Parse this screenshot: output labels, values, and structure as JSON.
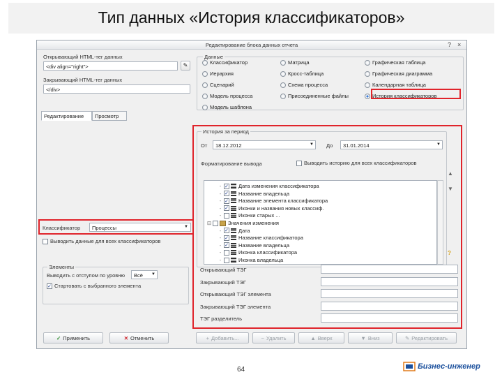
{
  "slide": {
    "title": "Тип данных «История классификаторов»",
    "page_number": "64",
    "brand": "Бизнес-инженер"
  },
  "window": {
    "title": "Редактирование блока данных отчета",
    "help_glyph": "?",
    "close_glyph": "×"
  },
  "left_panel": {
    "open_tag_label": "Открывающий HTML-тег данных",
    "open_tag_value": "<div align=\"right\">",
    "close_tag_label": "Закрывающий HTML-тег данных",
    "close_tag_value": "</div>",
    "picker_glyph": "✎",
    "tabs": [
      "Редактирование",
      "Просмотр"
    ],
    "classifier_label": "Классификатор",
    "classifier_value": "Процессы",
    "use_all_label": "Выводить данные для всех классификаторов",
    "elements_group": {
      "legend": "Элементы",
      "levels_label": "Выводить с отступом по уровню",
      "levels_value": "Всё",
      "start_selected_label": "Стартовать с выбранного элемента",
      "start_selected_checked": true
    }
  },
  "data_group": {
    "legend": "Данные",
    "options": [
      {
        "label": "Классификатор",
        "selected": false
      },
      {
        "label": "Матрица",
        "selected": false
      },
      {
        "label": "Графическая таблица",
        "selected": false
      },
      {
        "label": "Иерархия",
        "selected": false
      },
      {
        "label": "Кросс-таблица",
        "selected": false
      },
      {
        "label": "Графическая диаграмма",
        "selected": false
      },
      {
        "label": "Сценарий",
        "selected": false
      },
      {
        "label": "Схема процесса",
        "selected": false
      },
      {
        "label": "Календарная таблица",
        "selected": false
      },
      {
        "label": "Модель процесса",
        "selected": false
      },
      {
        "label": "Присоединенные файлы",
        "selected": false
      },
      {
        "label": "История классификаторов",
        "selected": true
      },
      {
        "label": "Модель шаблона",
        "selected": false
      }
    ]
  },
  "history": {
    "legend": "История за период",
    "from_label": "От",
    "from_value": "18.12.2012",
    "to_label": "До",
    "to_value": "31.01.2014",
    "fields_label": "Форматирование вывода",
    "fields_option_label": "Выводить историю для всех классификаторов",
    "tree": [
      {
        "label": "Дата изменения классификатора",
        "indent": 1,
        "checked": true,
        "kind": "item"
      },
      {
        "label": "Название владельца",
        "indent": 1,
        "checked": true,
        "kind": "item"
      },
      {
        "label": "Название элемента классификатора",
        "indent": 1,
        "checked": true,
        "kind": "item"
      },
      {
        "label": "Иконки и названия новых классиф.",
        "indent": 1,
        "checked": true,
        "kind": "item"
      },
      {
        "label": "Иконки старых ...",
        "indent": 1,
        "checked": false,
        "kind": "item"
      },
      {
        "label": "Значения изменения",
        "indent": 0,
        "checked": false,
        "kind": "group"
      },
      {
        "label": "Дата",
        "indent": 1,
        "checked": true,
        "kind": "item"
      },
      {
        "label": "Название классификатора",
        "indent": 1,
        "checked": true,
        "kind": "item"
      },
      {
        "label": "Название владельца",
        "indent": 1,
        "checked": true,
        "kind": "item"
      },
      {
        "label": "Иконка классификатора",
        "indent": 1,
        "checked": false,
        "kind": "item"
      },
      {
        "label": "Иконка владельца",
        "indent": 1,
        "checked": false,
        "kind": "item"
      }
    ],
    "tag_rows": [
      "Открывающий ТЭГ",
      "Закрывающий ТЭГ",
      "Открывающий ТЭГ элемента",
      "Закрывающий ТЭГ элемента",
      "ТЭГ разделитель"
    ],
    "question_glyph": "?"
  },
  "buttons": {
    "apply": "Применить",
    "cancel": "Отменить",
    "add": "Добавить...",
    "delete": "Удалить",
    "up": "Вверх",
    "down": "Вниз",
    "edit": "Редактировать"
  },
  "colors": {
    "highlight": "#e0242b",
    "brand": "#1a4f9c"
  }
}
